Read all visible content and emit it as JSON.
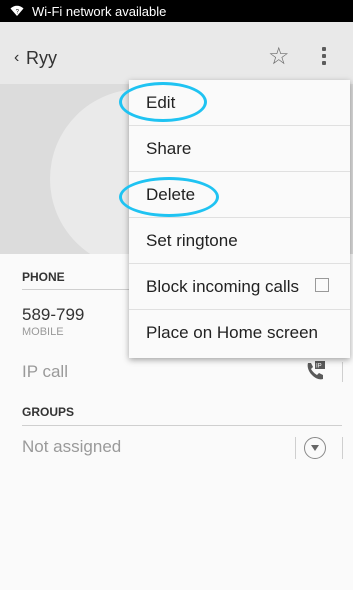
{
  "status_bar": {
    "text": "Wi-Fi network available"
  },
  "app_bar": {
    "back_glyph": "‹",
    "title": "Ryy"
  },
  "phone_section": {
    "label": "PHONE",
    "number": "589-799",
    "type": "MOBILE",
    "ip_call": "IP call"
  },
  "groups_section": {
    "label": "GROUPS",
    "value": "Not assigned"
  },
  "menu": {
    "items": [
      {
        "label": "Edit"
      },
      {
        "label": "Share"
      },
      {
        "label": "Delete"
      },
      {
        "label": "Set ringtone"
      },
      {
        "label": "Block incoming calls"
      },
      {
        "label": "Place on Home screen"
      }
    ]
  },
  "colors": {
    "highlight": "#1fc3f2",
    "statusbar": "#000000",
    "appbar": "#e9e9e9"
  },
  "icons": [
    "wifi-icon",
    "star-icon",
    "overflow-menu-icon",
    "ip-call-icon",
    "chevron-down-icon"
  ]
}
